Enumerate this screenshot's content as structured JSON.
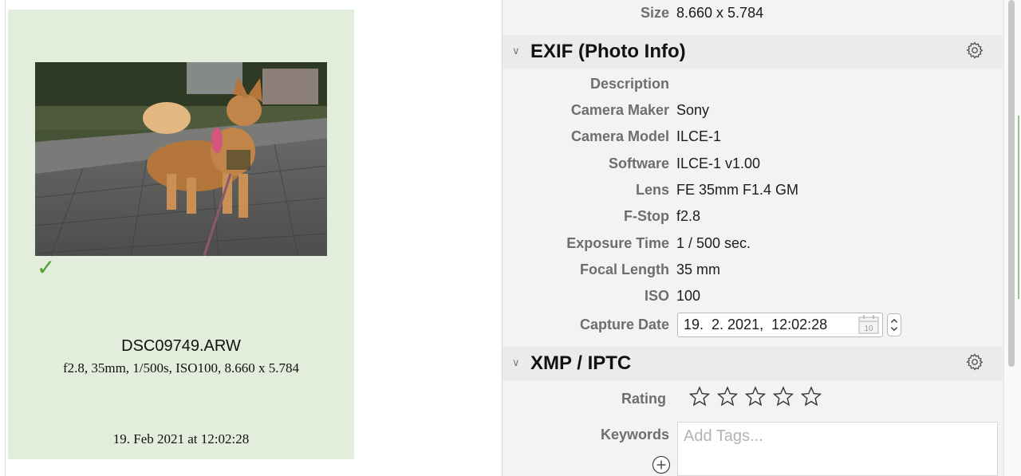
{
  "thumbnail": {
    "filename": "DSC09749.ARW",
    "exif_summary": "f2.8, 35mm, 1/500s, ISO100, 8.660 x 5.784",
    "date": "19. Feb 2021 at 12:02:28",
    "checked": true,
    "check_glyph": "✓",
    "background": "#e2eddb",
    "check_color": "#4fa233"
  },
  "inspector": {
    "size_row": {
      "label": "Size",
      "value": "8.660 x 5.784"
    },
    "exif": {
      "title": "EXIF (Photo Info)",
      "chevron": "∨",
      "gear_icon": "gear-icon",
      "rows": [
        {
          "label": "Description",
          "value": ""
        },
        {
          "label": "Camera Maker",
          "value": "Sony"
        },
        {
          "label": "Camera Model",
          "value": "ILCE-1"
        },
        {
          "label": "Software",
          "value": "ILCE-1 v1.00"
        },
        {
          "label": "Lens",
          "value": "FE 35mm F1.4 GM"
        },
        {
          "label": "F-Stop",
          "value": "f2.8"
        },
        {
          "label": "Exposure Time",
          "value": "1 / 500 sec."
        },
        {
          "label": "Focal Length",
          "value": "35 mm"
        },
        {
          "label": "ISO",
          "value": "100"
        }
      ],
      "capture_date": {
        "label": "Capture Date",
        "value": "19.  2. 2021,  12:02:28",
        "calendar_icon": "calendar-icon",
        "calendar_day": "10"
      }
    },
    "xmp": {
      "title": "XMP / IPTC",
      "chevron": "∨",
      "gear_icon": "gear-icon",
      "rating": {
        "label": "Rating",
        "value": 0,
        "max": 5
      },
      "keywords": {
        "label": "Keywords",
        "placeholder": "Add Tags..."
      }
    }
  }
}
